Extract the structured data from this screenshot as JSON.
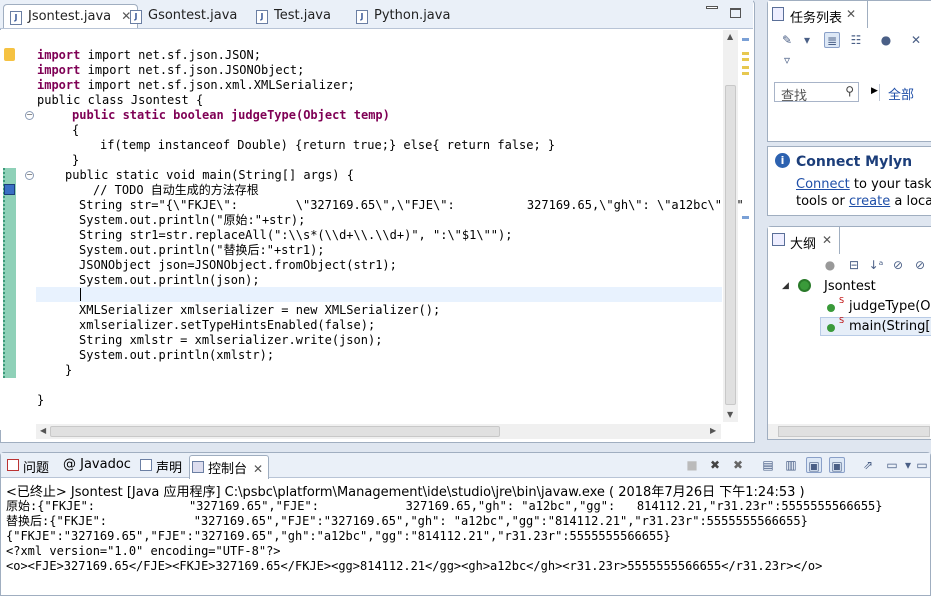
{
  "editor": {
    "tabs": [
      {
        "label": "Jsontest.java",
        "active": true,
        "close": "✕"
      },
      {
        "label": "Gsontest.java",
        "active": false
      },
      {
        "label": "Test.java",
        "active": false
      },
      {
        "label": "Python.java",
        "active": false
      }
    ],
    "file_icon_letter": "J"
  },
  "code": {
    "imports": [
      "import net.sf.json.JSON;",
      "import net.sf.json.JSONObject;",
      "import net.sf.json.xml.XMLSerializer;"
    ],
    "class_decl": "public class Jsontest {",
    "judge_sig": "public static boolean judgeType(Object temp)",
    "brace_open": "{",
    "if_line": "if(temp instanceof Double) {return true;} else{ return false; }",
    "brace_close": "}",
    "main_sig": "public static void main(String[] args) {",
    "todo_comment": "// TODO 自动生成的方法存根",
    "str_line": "String str=\"{\\\"FKJE\\\":        \\\"327169.65\\\",\\\"FJE\\\":          327169.65,\\\"gh\\\": \\\"a12bc\\\",\\\"",
    "print1": "System.out.println(\"原始:\"+str);",
    "str1_line": "String str1=str.replaceAll(\":\\\\s*(\\\\d+\\\\.\\\\d+)\", \":\\\"$1\\\"\");",
    "print2": "System.out.println(\"替换后:\"+str1);",
    "json_line": "JSONObject json=JSONObject.fromObject(str1);",
    "print3": "System.out.println(json);",
    "xml_line": "XMLSerializer xmlserializer = new XMLSerializer();",
    "hint_line": "xmlserializer.setTypeHintsEnabled(false);",
    "xmlstr_line": "String xmlstr = xmlserializer.write(json);",
    "print4": "System.out.println(xmlstr);",
    "close_method": "}",
    "close_class": "}"
  },
  "tasks_panel": {
    "title": "任务列表",
    "search_placeholder": "查找",
    "filter_all": "全部"
  },
  "mylyn": {
    "title": "Connect Mylyn",
    "connect_link": "Connect",
    "text1": " to your task an",
    "text2": "tools or ",
    "create_link": "create",
    "text3": " a local t"
  },
  "outline_panel": {
    "title": "大纲",
    "class_name": "Jsontest",
    "members": [
      "judgeType(Ob",
      "main(String[]"
    ]
  },
  "console_panel": {
    "tabs": [
      "问题",
      "@ Javadoc",
      "声明",
      "控制台"
    ],
    "header": "<已终止> Jsontest [Java 应用程序] C:\\psbc\\platform\\Management\\ide\\studio\\jre\\bin\\javaw.exe ( 2018年7月26日 下午1:24:53 )",
    "lines": [
      "原始:{\"FKJE\":             \"327169.65\",\"FJE\":            327169.65,\"gh\": \"a12bc\",\"gg\":   814112.21,\"r31.23r\":5555555566655}",
      "替换后:{\"FKJE\":            \"327169.65\",\"FJE\":\"327169.65\",\"gh\": \"a12bc\",\"gg\":\"814112.21\",\"r31.23r\":5555555566655}",
      "{\"FKJE\":\"327169.65\",\"FJE\":\"327169.65\",\"gh\":\"a12bc\",\"gg\":\"814112.21\",\"r31.23r\":5555555566655}",
      "<?xml version=\"1.0\" encoding=\"UTF-8\"?>",
      "<o><FJE>327169.65</FJE><FKJE>327169.65</FKJE><gg>814112.21</gg><gh>a12bc</gh><r31.23r>5555555566655</r31.23r></o>"
    ]
  },
  "colors": {
    "keyword": "#7f0055",
    "string": "#2a00ff",
    "comment": "#3f7f5f",
    "variable": "#6a3e3e",
    "static_field": "#0000c0"
  }
}
